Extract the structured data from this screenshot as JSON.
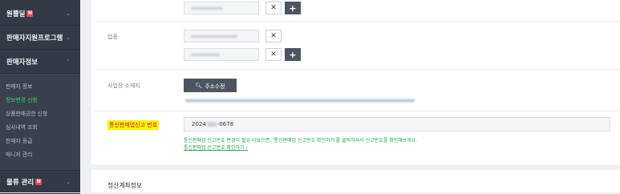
{
  "sidebar": {
    "sections": [
      {
        "label": "원쁠딜",
        "badge": "N",
        "top": 0
      },
      {
        "label": "판매자지원프로그램",
        "badge": "",
        "top": 0
      },
      {
        "label": "판매자정보",
        "badge": "",
        "top": 0
      },
      {
        "label": "물류 관리",
        "badge": "N",
        "top": 0
      }
    ],
    "items": [
      {
        "label": "판매자 정보"
      },
      {
        "label": "정보변경 신청"
      },
      {
        "label": "상품판매권한 신청"
      },
      {
        "label": "심사내역 조회"
      },
      {
        "label": "판매자 등급"
      },
      {
        "label": "매니저 관리"
      }
    ]
  },
  "form": {
    "industry_label": "업종",
    "address_label": "사업장 소재지",
    "address_button": "주소수정",
    "reg_label": "통신판매업신고 번호",
    "reg_prefix": "2024",
    "reg_suffix": "-0678",
    "notice": "통신판매업 신고번호 변경이 필요 되었으면, '통신판매업 신고번호 확인하기'를 클릭하셔서 신고번호를 확인해보세요.",
    "notice_link": "통신판매업 신고번호 확인하기 ›",
    "remove_glyph": "✕",
    "add_glyph": "+"
  },
  "settlement": {
    "title": "정산계좌정보"
  },
  "colors": {
    "sidebar_bg": "#333a45",
    "active_item": "#2fd36b",
    "badge": "#e5484d",
    "highlight_bg": "#f7f200",
    "highlight_text": "#d21c1c",
    "notice_text": "#23a455"
  }
}
